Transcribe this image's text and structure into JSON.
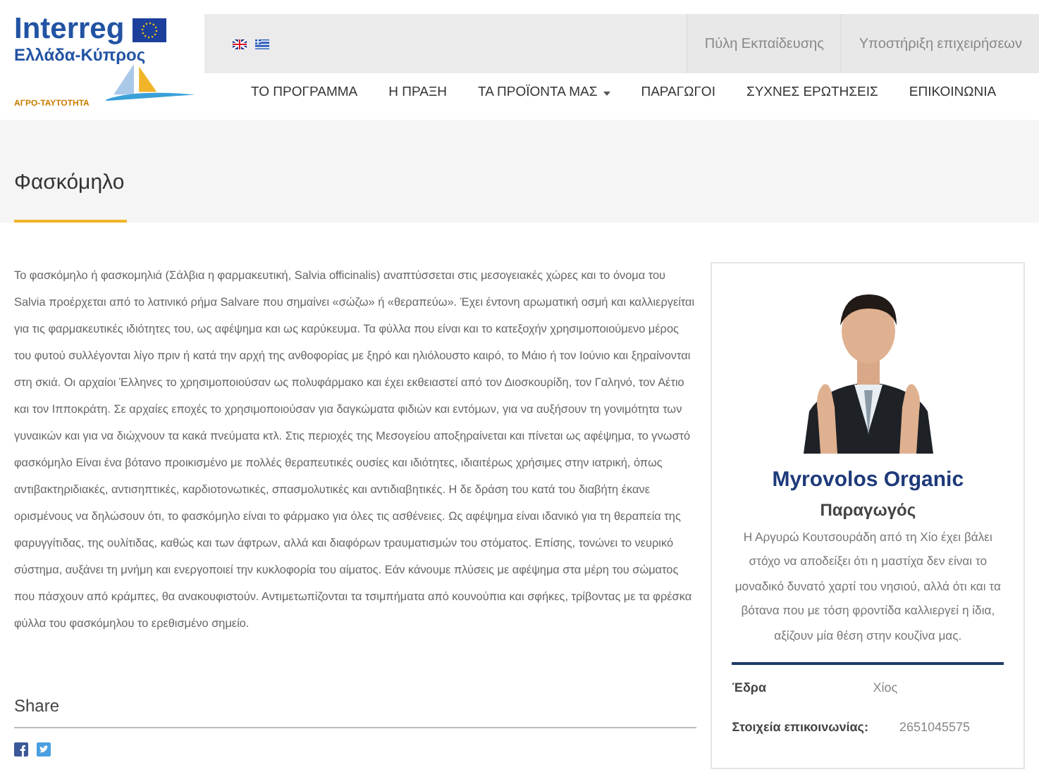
{
  "logo": {
    "title": "Interreg",
    "subtitle": "Ελλάδα-Κύπρος",
    "project": "ΑΓΡΟ-ΤΑΥΤΟΤΗΤΑ"
  },
  "languages": [
    {
      "kind": "uk"
    },
    {
      "kind": "gr"
    }
  ],
  "top_links": [
    "Πύλη Εκπαίδευσης",
    "Υποστήριξη επιχειρήσεων"
  ],
  "nav": [
    {
      "label": "ΤΟ ΠΡΟΓΡΑΜΜΑ",
      "dropdown": false
    },
    {
      "label": "Η ΠΡΑΞΗ",
      "dropdown": false
    },
    {
      "label": "ΤΑ ΠΡΟΪΟΝΤΑ ΜΑΣ",
      "dropdown": true
    },
    {
      "label": "ΠΑΡΑΓΩΓΟΙ",
      "dropdown": false
    },
    {
      "label": "ΣΥΧΝΕΣ ΕΡΩΤΗΣΕΙΣ",
      "dropdown": false
    },
    {
      "label": "ΕΠΙΚΟΙΝΩΝΙΑ",
      "dropdown": false
    }
  ],
  "page_title": "Φασκόμηλο",
  "article": "Το φασκόμηλο ή φασκομηλιά (Σάλβια η φαρμακευτική, Salvia officinalis) αναπτύσσεται στις μεσογειακές χώρες και το όνομα του Salvia  προέρχεται από το λατινικό ρήμα Salvare που σημαίνει «σώζω» ή «θεραπεύω». Έχει έντονη αρωματική οσμή και καλλιεργείται για τις φαρμακευτικές ιδιότητες του, ως αφέψημα και ως καρύκευμα. Τα φύλλα που είναι και το κατεξοχήν χρησιμοποιούμενο μέρος του φυτού συλλέγονται λίγο πριν ή κατά την αρχή της ανθοφορίας με ξηρό και ηλιόλουστο καιρό, το Μάιο ή τον Ιούνιο και ξηραίνονται στη σκιά. Οι αρχαίοι Έλληνες το χρησιμοποιούσαν ως πολυφάρμακο και έχει εκθειαστεί από τον Διοσκουρίδη, τον Γαληνό, τον Αέτιο και τον Ιπποκράτη. Σε αρχαίες εποχές το χρησιμοποιούσαν για δαγκώματα φιδιών και εντόμων, για να αυξήσουν τη γονιμότητα των γυναικών και για να διώχνουν τα κακά πνεύματα κτλ. Στις περιοχές της Μεσογείου αποξηραίνεται και πίνεται ως αφέψημα, το γνωστό φασκόμηλο Είναι ένα βότανο προικισμένο με πολλές θεραπευτικές ουσίες και ιδιότητες, ιδιαιτέρως χρήσιμες στην ιατρική, όπως αντιβακτηριδιακές, αντισηπτικές, καρδιοτονωτικές, σπασμολυτικές και αντιδιαβητικές. Η δε δράση του κατά του διαβήτη έκανε ορισμένους να δηλώσουν ότι, το φασκόμηλο είναι το φάρμακο για όλες τις ασθένειες. Ως αφέψημα είναι ιδανικό για τη θεραπεία της φαρυγγίτιδας, της ουλίτιδας, καθώς και των άφτρων, αλλά και διαφόρων τραυματισμών του στόματος. Επίσης, τονώνει το νευρικό σύστημα, αυξάνει τη μνήμη και ενεργοποιεί την κυκλοφορία του αίματος. Εάν κάνουμε πλύσεις με αφέψημα στα μέρη του σώματος που πάσχουν από κράμπες, θα ανακουφιστούν. Αντιμετωπίζονται τα τσιμπήματα από κουνούπια και σφήκες, τρίβοντας με τα φρέσκα φύλλα του φασκόμηλου το ερεθισμένο σημείο.",
  "share": {
    "title": "Share",
    "buttons": [
      {
        "kind": "facebook"
      },
      {
        "kind": "twitter"
      }
    ]
  },
  "producer": {
    "name": "Myrovolos Organic",
    "role": "Παραγωγός",
    "bio": "Η Αργυρώ Κουτσουράδη από τη Χίο έχει βάλει στόχο να αποδείξει ότι η μαστίχα δεν είναι το μοναδικό δυνατό χαρτί του νησιού, αλλά ότι και τα βότανα που με τόση φροντίδα καλλιεργεί η ίδια, αξίζουν μία θέση στην κουζίνα μας.",
    "details": [
      {
        "label": "Έδρα",
        "value": "Χίος"
      },
      {
        "label": "Στοιχεία επικοινωνίας:",
        "value": "2651045575"
      }
    ]
  }
}
